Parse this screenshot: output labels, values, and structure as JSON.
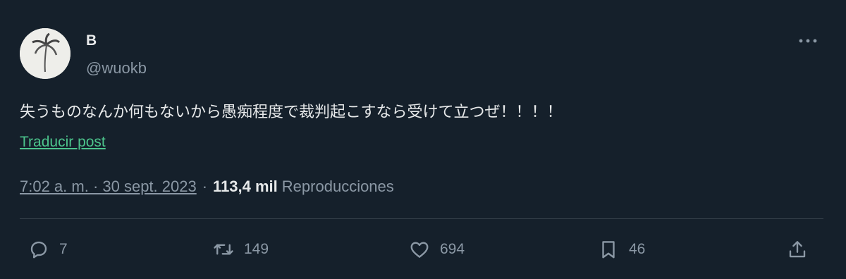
{
  "user": {
    "display_name": "B",
    "handle": "@wuokb"
  },
  "tweet": {
    "text": "失うものなんか何もないから愚痴程度で裁判起こすなら受けて立つぜ！！！！",
    "translate_label": "Traducir post",
    "timestamp": "7:02 a. m. · 30 sept. 2023",
    "separator": "·",
    "views_count": "113,4 mil",
    "views_label": "Reproducciones"
  },
  "actions": {
    "replies": "7",
    "retweets": "149",
    "likes": "694",
    "bookmarks": "46"
  },
  "icons": {
    "more": "more-icon",
    "reply": "reply-icon",
    "retweet": "retweet-icon",
    "like": "heart-icon",
    "bookmark": "bookmark-icon",
    "share": "share-icon"
  },
  "colors": {
    "background": "#15202b",
    "text": "#e7e9ea",
    "secondary": "#8b98a5",
    "link": "#4cc48c"
  }
}
